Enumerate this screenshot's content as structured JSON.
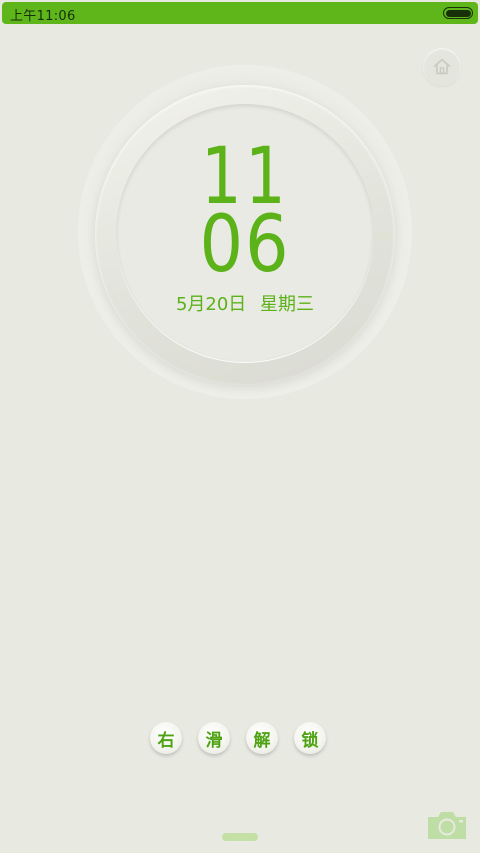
{
  "status_bar": {
    "time": "上午11:06",
    "accent_color": "#5fb61b"
  },
  "lock": {
    "hour": "11",
    "minute": "06",
    "date": "5月20日",
    "weekday": "星期三",
    "clock_color": "#5cb219"
  },
  "unlock": {
    "chars": [
      "右",
      "滑",
      "解",
      "锁"
    ]
  },
  "icons": {
    "home": "home-icon",
    "camera": "camera-icon",
    "battery": "battery-icon"
  }
}
